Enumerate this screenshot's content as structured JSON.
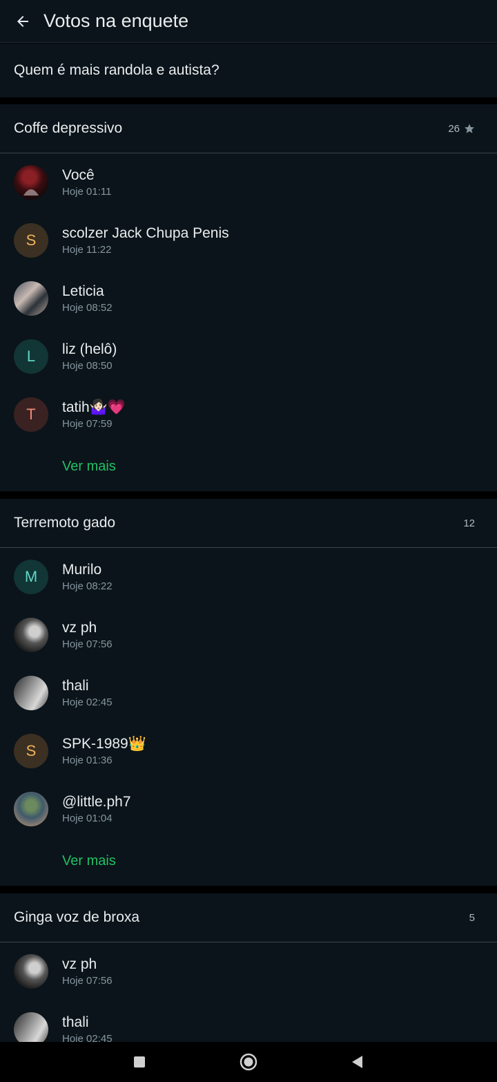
{
  "header": {
    "title": "Votos na enquete",
    "back_icon": "arrow-left-icon"
  },
  "question": "Quem é mais randola e autista?",
  "colors": {
    "background": "#0b141a",
    "accent": "#21c063",
    "divider": "#000000"
  },
  "sections": [
    {
      "title": "Coffe depressivo",
      "count": "26",
      "starred": true,
      "voters": [
        {
          "name": "Você",
          "time": "Hoje 01:11",
          "avatar": "photo"
        },
        {
          "name": "scolzer Jack Chupa Penis",
          "time": "Hoje 11:22",
          "initial": "S"
        },
        {
          "name": "Leticia",
          "time": "Hoje 08:52",
          "avatar": "photo"
        },
        {
          "name": "liz (helô)",
          "time": "Hoje 08:50",
          "initial": "L"
        },
        {
          "name": "tatih🤷🏻‍♀️💗",
          "time": "Hoje 07:59",
          "initial": "T"
        }
      ],
      "see_more": "Ver mais"
    },
    {
      "title": "Terremoto gado",
      "count": "12",
      "starred": false,
      "voters": [
        {
          "name": "Murilo",
          "time": "Hoje 08:22",
          "initial": "M"
        },
        {
          "name": "vz ph",
          "time": "Hoje 07:56",
          "avatar": "photo"
        },
        {
          "name": "thali",
          "time": "Hoje 02:45",
          "avatar": "photo"
        },
        {
          "name": "SPK-1989👑",
          "time": "Hoje 01:36",
          "initial": "S"
        },
        {
          "name": "@little.ph7",
          "time": "Hoje 01:04",
          "avatar": "photo"
        }
      ],
      "see_more": "Ver mais"
    },
    {
      "title": "Ginga voz de broxa",
      "count": "5",
      "starred": false,
      "voters": [
        {
          "name": "vz ph",
          "time": "Hoje 07:56",
          "avatar": "photo"
        },
        {
          "name": "thali",
          "time": "Hoje 02:45",
          "avatar": "photo"
        }
      ]
    }
  ],
  "nav": {
    "recents_icon": "square-icon",
    "home_icon": "circle-icon",
    "back_icon": "triangle-back-icon"
  }
}
